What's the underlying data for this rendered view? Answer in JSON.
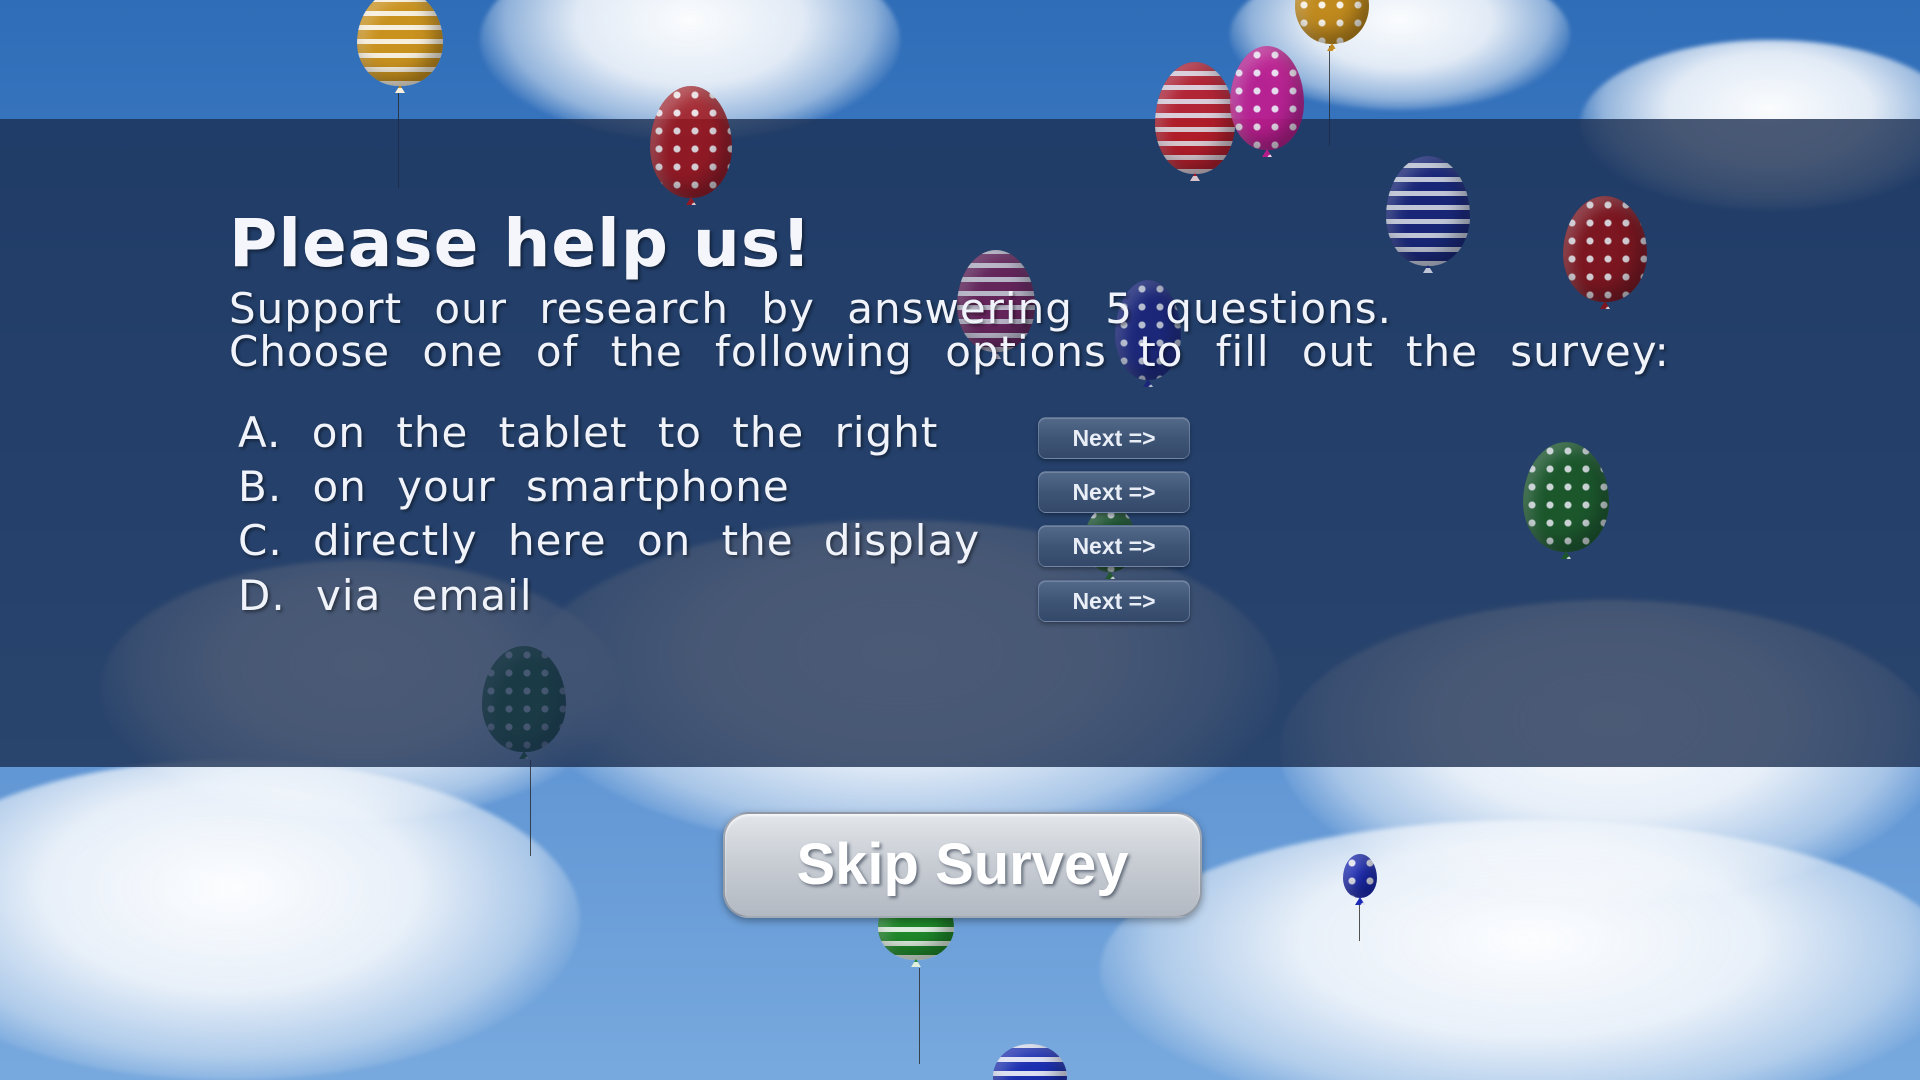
{
  "survey": {
    "title": "Please help us!",
    "subtitle_line1": "Support our research by answering 5 questions.",
    "subtitle_line2": "Choose one of the following options to fill out the survey:",
    "options": [
      {
        "label": "A. on the tablet to the right",
        "button": "Next =>"
      },
      {
        "label": "B. on your smartphone",
        "button": "Next =>"
      },
      {
        "label": "C. directly here on the display",
        "button": "Next =>"
      },
      {
        "label": "D. via email",
        "button": "Next =>"
      }
    ],
    "skip_label": "Skip Survey"
  },
  "colors": {
    "sky": "#4d86cc",
    "overlay": "#1a2d4f",
    "next_button": "#3f5576",
    "skip_button": "#c9ced5"
  }
}
